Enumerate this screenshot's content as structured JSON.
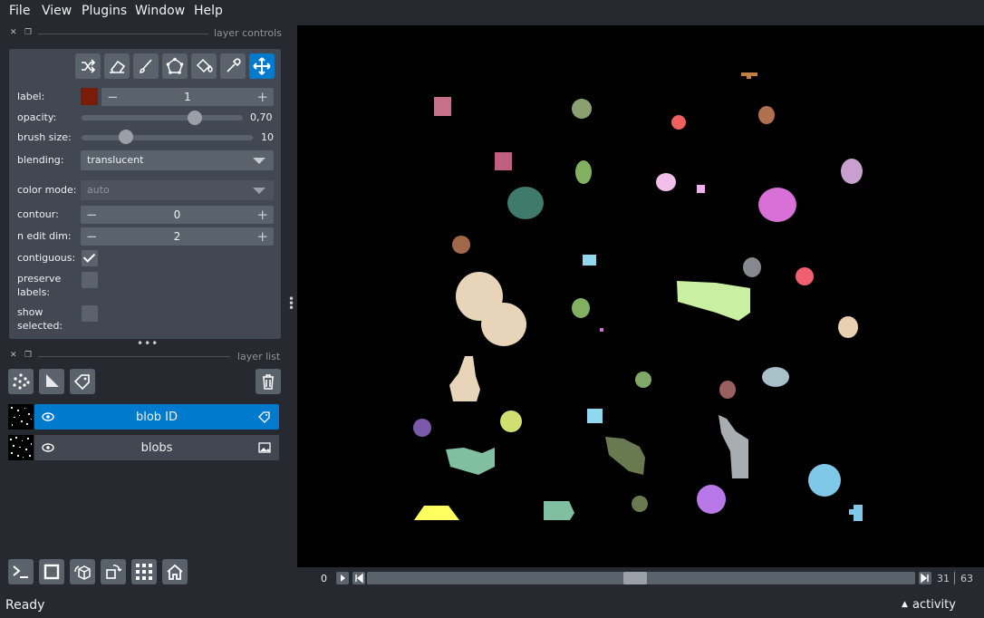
{
  "menubar": {
    "items": [
      "File",
      "View",
      "Plugins",
      "Window",
      "Help"
    ]
  },
  "layer_controls": {
    "title": "layer controls",
    "tools": [
      {
        "name": "shuffle-colors-icon",
        "active": false
      },
      {
        "name": "eraser-icon",
        "active": false
      },
      {
        "name": "paintbrush-icon",
        "active": false
      },
      {
        "name": "polygon-icon",
        "active": false
      },
      {
        "name": "fill-bucket-icon",
        "active": false
      },
      {
        "name": "color-picker-icon",
        "active": false
      },
      {
        "name": "move-pan-icon",
        "active": true
      }
    ],
    "label": {
      "label": "label:",
      "value": "1",
      "swatch": "#7a1c0a"
    },
    "opacity": {
      "label": "opacity:",
      "value": "0,70",
      "fraction": 0.7
    },
    "brush_size": {
      "label": "brush size:",
      "value": "10",
      "fraction": 0.26
    },
    "blending": {
      "label": "blending:",
      "value": "translucent"
    },
    "color_mode": {
      "label": "color mode:",
      "value": "auto"
    },
    "contour": {
      "label": "contour:",
      "value": "0"
    },
    "n_edit_dim": {
      "label": "n edit dim:",
      "value": "2"
    },
    "contiguous": {
      "label": "contiguous:",
      "checked": true
    },
    "preserve_labels": {
      "label": "preserve labels:",
      "label_line1": "preserve",
      "label_line2": "labels:",
      "checked": false
    },
    "show_selected": {
      "label": "show selected:",
      "label_line1": "show",
      "label_line2": "selected:",
      "checked": false
    }
  },
  "layer_list": {
    "title": "layer list",
    "layers": [
      {
        "name": "blob ID",
        "visible": true,
        "selected": true,
        "type_icon": "labels-tag-icon"
      },
      {
        "name": "blobs",
        "visible": true,
        "selected": false,
        "type_icon": "image-icon"
      }
    ]
  },
  "bottom_toolbar": [
    "console-icon",
    "2d-3d-toggle-icon",
    "roll-dims-icon",
    "transpose-icon",
    "grid-icon",
    "home-icon"
  ],
  "dims_slider": {
    "current": "0",
    "position": "31",
    "total": "63",
    "fraction": 0.49
  },
  "status": {
    "text": "Ready",
    "activity": "activity"
  },
  "colors": {
    "accent": "#007acc",
    "panel": "#414851",
    "background": "#262930",
    "widget": "#5a626c"
  }
}
